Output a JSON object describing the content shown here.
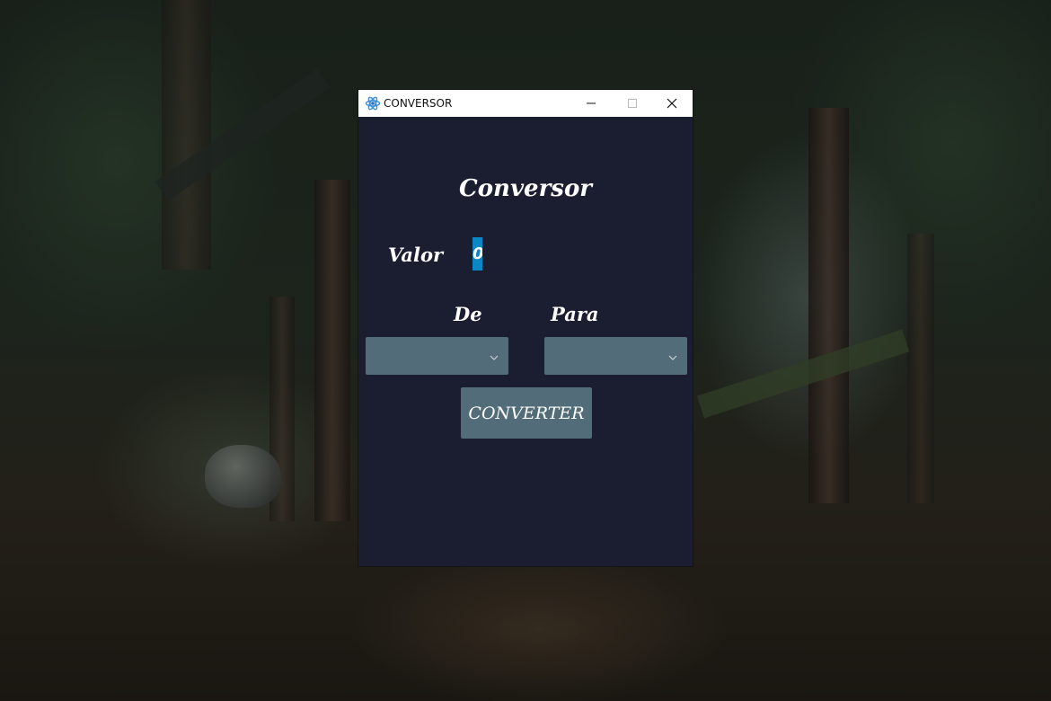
{
  "window": {
    "title": "CONVERSOR",
    "minimize_icon": "minimize-icon",
    "maximize_icon": "maximize-icon",
    "close_icon": "close-icon",
    "app_icon": "atom-icon"
  },
  "form": {
    "heading": "Conversor",
    "valor_label": "Valor",
    "valor_value": "0",
    "de_label": "De",
    "para_label": "Para",
    "de_selected": "",
    "para_selected": "",
    "convert_label": "CONVERTER"
  },
  "colors": {
    "window_bg": "#1b1d30",
    "control_bg": "#526c7a",
    "input_highlight": "#0a87c4",
    "text": "#ffffff"
  }
}
